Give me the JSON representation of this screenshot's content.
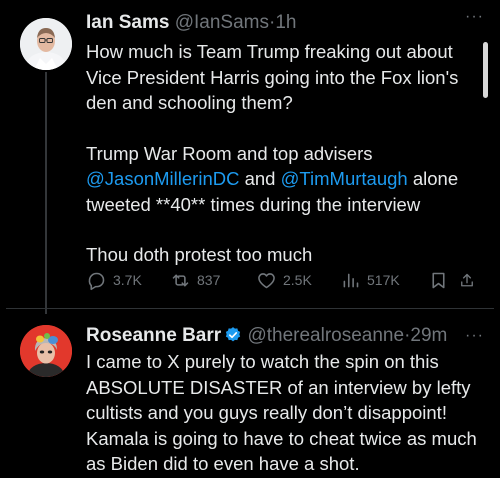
{
  "tweet1": {
    "name": "Ian Sams",
    "handle": "@IanSams",
    "time": "1h",
    "more": "···",
    "para1": "How much is Team Trump freaking out about Vice President Harris going into the Fox lion's den and schooling them?",
    "para2_a": "Trump War Room and top advisers ",
    "mention1": "@JasonMillerinDC",
    "para2_b": " and ",
    "mention2": "@TimMurtaugh",
    "para2_c": " alone tweeted **40** times during the interview",
    "para3": "Thou doth protest too much",
    "actions": {
      "replies": "3.7K",
      "reposts": "837",
      "likes": "2.5K",
      "views": "517K"
    }
  },
  "tweet2": {
    "name": "Roseanne Barr",
    "handle": "@therealroseanne",
    "time": "29m",
    "more": "···",
    "text": "I came to X purely to watch the spin on this ABSOLUTE DISASTER of an interview by lefty cultists and you guys really don’t disappoint! Kamala is going to have to cheat twice as much as Biden did to even have a shot."
  },
  "colors": {
    "background": "#000000",
    "text": "#e7e9ea",
    "muted": "#71767b",
    "link": "#1d9bf0",
    "verified": "#1d9bf0"
  }
}
